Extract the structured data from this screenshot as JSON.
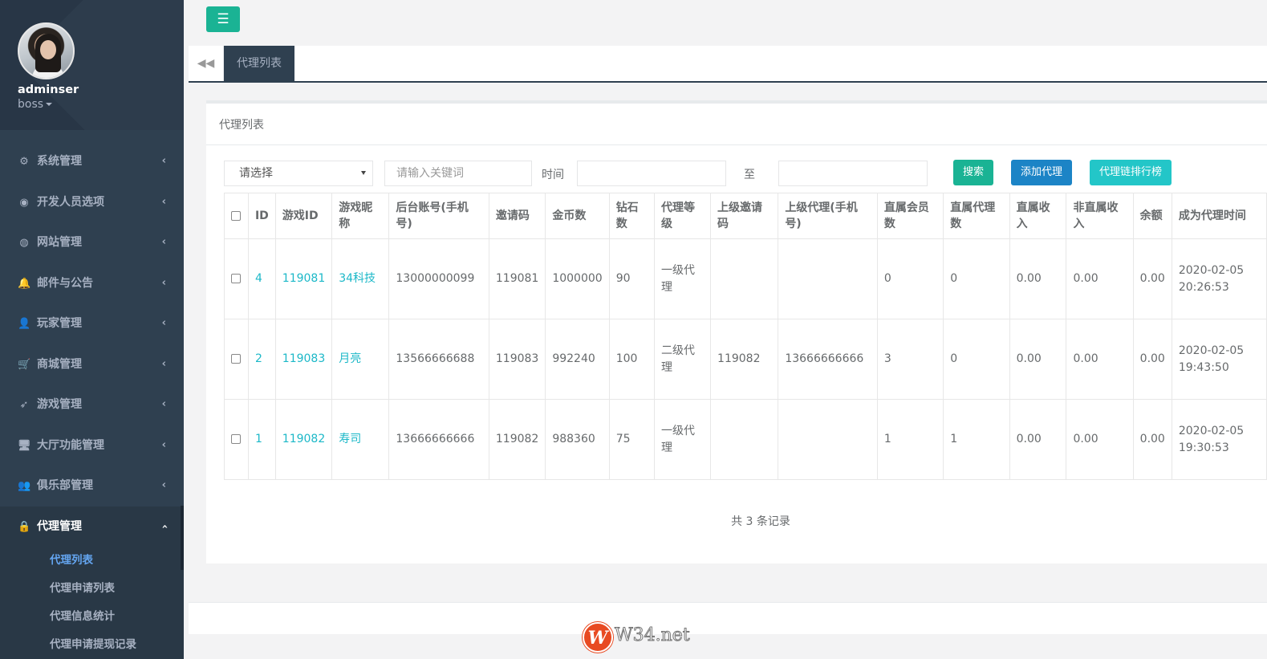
{
  "profile": {
    "name": "adminser",
    "role": "boss"
  },
  "menu": [
    {
      "label": "系统管理",
      "icon": "cogs-icon",
      "glyph": "⚙"
    },
    {
      "label": "开发人员选项",
      "icon": "gamepad-icon",
      "glyph": "◉"
    },
    {
      "label": "网站管理",
      "icon": "globe-icon",
      "glyph": "◍"
    },
    {
      "label": "邮件与公告",
      "icon": "bell-icon",
      "glyph": "🔔"
    },
    {
      "label": "玩家管理",
      "icon": "user-icon",
      "glyph": "👤"
    },
    {
      "label": "商城管理",
      "icon": "cart-icon",
      "glyph": "🛒"
    },
    {
      "label": "游戏管理",
      "icon": "rocket-icon",
      "glyph": "➶"
    },
    {
      "label": "大厅功能管理",
      "icon": "desktop-icon",
      "glyph": "🖥"
    },
    {
      "label": "俱乐部管理",
      "icon": "users-icon",
      "glyph": "👥"
    },
    {
      "label": "代理管理",
      "icon": "user-secret-icon",
      "glyph": "🔒"
    }
  ],
  "submenu": [
    "代理列表",
    "代理申请列表",
    "代理信息统计",
    "代理申请提现记录"
  ],
  "tabs": {
    "active": "代理列表"
  },
  "panel": {
    "title": "代理列表"
  },
  "filters": {
    "select_value": "请选择",
    "keyword_placeholder": "请输入关键词",
    "time_label": "时间",
    "to_label": "至",
    "search_button": "搜索",
    "add_button": "添加代理",
    "rank_button": "代理链排行榜"
  },
  "table": {
    "headers": [
      "ID",
      "游戏ID",
      "游戏昵称",
      "后台账号(手机号)",
      "邀请码",
      "金币数",
      "钻石数",
      "代理等级",
      "上级邀请码",
      "上级代理(手机号)",
      "直属会员数",
      "直属代理数",
      "直属收入",
      "非直属收入",
      "余额",
      "成为代理时间"
    ],
    "rows": [
      [
        "4",
        "119081",
        "34科技",
        "13000000099",
        "119081",
        "1000000",
        "90",
        "一级代理",
        "",
        "",
        "0",
        "0",
        "0.00",
        "0.00",
        "0.00",
        "2020-02-05 20:26:53"
      ],
      [
        "2",
        "119083",
        "月亮",
        "13566666688",
        "119083",
        "992240",
        "100",
        "二级代理",
        "119082",
        "13666666666",
        "3",
        "0",
        "0.00",
        "0.00",
        "0.00",
        "2020-02-05 19:43:50"
      ],
      [
        "1",
        "119082",
        "寿司",
        "13666666666",
        "119082",
        "988360",
        "75",
        "一级代理",
        "",
        "",
        "1",
        "1",
        "0.00",
        "0.00",
        "0.00",
        "2020-02-05 19:30:53"
      ]
    ]
  },
  "summary": "共 3 条记录",
  "watermark": {
    "letter": "W",
    "text": "W34.net"
  },
  "colors": {
    "sidebar": "#2f4050",
    "primary": "#1ab394",
    "blue": "#1c84c6",
    "info": "#23c6c8",
    "link": "#1cb8c8"
  }
}
